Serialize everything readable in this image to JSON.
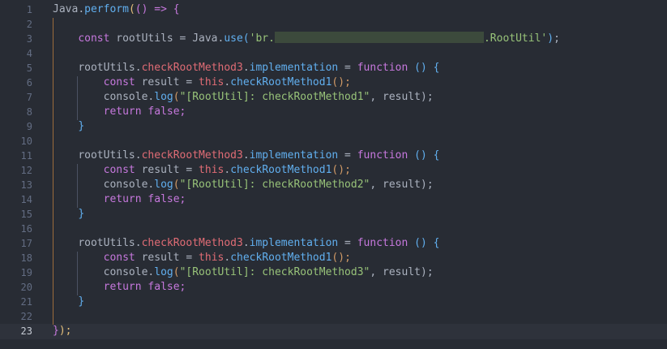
{
  "editor": {
    "line_numbers": [
      "1",
      "2",
      "3",
      "4",
      "5",
      "6",
      "7",
      "8",
      "9",
      "10",
      "11",
      "12",
      "13",
      "14",
      "15",
      "16",
      "17",
      "18",
      "19",
      "20",
      "21",
      "22",
      "23"
    ],
    "current_line": "23",
    "tokens": {
      "java": "Java",
      "perform": "perform",
      "open_paren": "(",
      "arrow_params": "()",
      "arrow": " => ",
      "open_brace": "{",
      "close_brace": "}",
      "close_call": ");",
      "const": "const",
      "root_utils_decl": " rootUtils = ",
      "dot": ".",
      "use": "use",
      "string_prefix": "'br.",
      "string_suffix": ".RootUtil'",
      "root_utils": "rootUtils",
      "check_root_method3": "checkRootMethod3",
      "implementation": "implementation",
      "assign": " = ",
      "function": "function",
      "func_params": " () ",
      "result_decl": " result = ",
      "this": "this",
      "check_root_method1": "checkRootMethod1",
      "call_end": "();",
      "console": "console",
      "log": "log",
      "log_args_end": ", result);",
      "return": "return",
      "false_end": " false;",
      "msg1": "\"[RootUtil]: checkRootMethod1\"",
      "msg2": "\"[RootUtil]: checkRootMethod2\"",
      "msg3": "\"[RootUtil]: checkRootMethod3\""
    }
  }
}
